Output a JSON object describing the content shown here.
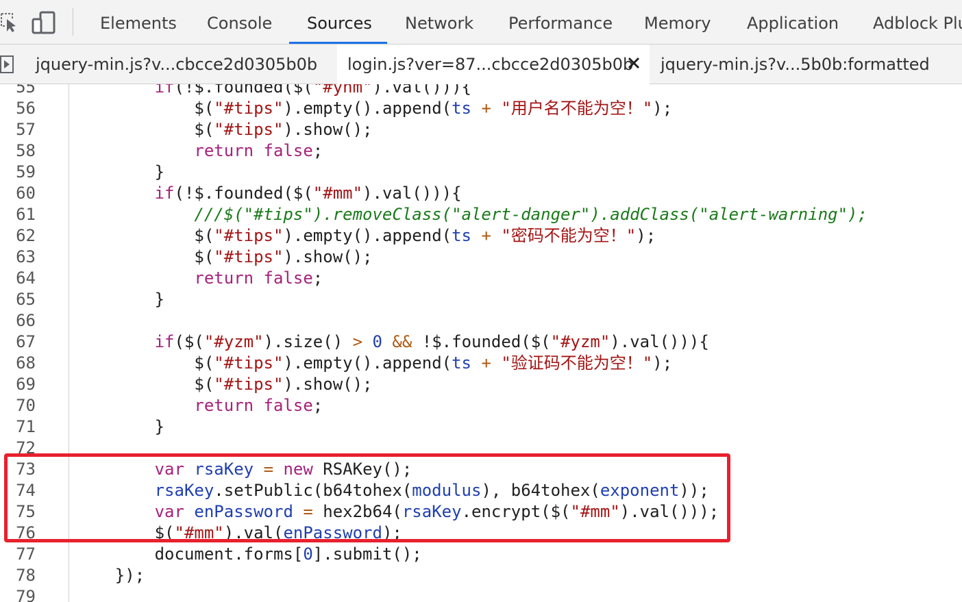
{
  "toolbar": {
    "tabs": [
      {
        "label": "Elements"
      },
      {
        "label": "Console"
      },
      {
        "label": "Sources"
      },
      {
        "label": "Network"
      },
      {
        "label": "Performance"
      },
      {
        "label": "Memory"
      },
      {
        "label": "Application"
      },
      {
        "label": "Adblock Plus"
      }
    ],
    "active_tab": "Sources",
    "icons": [
      "inspect-element-icon",
      "device-toggle-icon"
    ]
  },
  "file_tabs": [
    {
      "label": "jquery-min.js?v...cbcce2d0305b0b",
      "active": false
    },
    {
      "label": "login.js?ver=87...cbcce2d0305b0b",
      "active": true
    },
    {
      "label": "jquery-min.js?v...5b0b:formatted",
      "active": false
    }
  ],
  "colors": {
    "keyword": "#a5227c",
    "string": "#a31515",
    "comment": "#1a7a1a",
    "variable": "#1f3fb0",
    "highlight_border": "#e8202e",
    "active_tab_underline": "#1a73e8"
  },
  "code": {
    "highlighted_lines": [
      "73",
      "74",
      "75",
      "76"
    ],
    "lines": [
      {
        "n": "55",
        "segs": [
          {
            "t": "        "
          },
          {
            "t": "if",
            "c": "k"
          },
          {
            "t": "(!$.founded($("
          },
          {
            "t": "\"#ynm\"",
            "c": "s"
          },
          {
            "t": ").val())){"
          }
        ]
      },
      {
        "n": "56",
        "segs": [
          {
            "t": "            $("
          },
          {
            "t": "\"#tips\"",
            "c": "s"
          },
          {
            "t": ").empty().append("
          },
          {
            "t": "ts",
            "c": "v"
          },
          {
            "t": " "
          },
          {
            "t": "+",
            "c": "o"
          },
          {
            "t": " "
          },
          {
            "t": "\"用户名不能为空！\"",
            "c": "s"
          },
          {
            "t": ");"
          }
        ]
      },
      {
        "n": "57",
        "segs": [
          {
            "t": "            $("
          },
          {
            "t": "\"#tips\"",
            "c": "s"
          },
          {
            "t": ").show();"
          }
        ]
      },
      {
        "n": "58",
        "segs": [
          {
            "t": "            "
          },
          {
            "t": "return false",
            "c": "k"
          },
          {
            "t": ";"
          }
        ]
      },
      {
        "n": "59",
        "segs": [
          {
            "t": "        }"
          }
        ]
      },
      {
        "n": "60",
        "segs": [
          {
            "t": "        "
          },
          {
            "t": "if",
            "c": "k"
          },
          {
            "t": "(!$.founded($("
          },
          {
            "t": "\"#mm\"",
            "c": "s"
          },
          {
            "t": ").val())){"
          }
        ]
      },
      {
        "n": "61",
        "segs": [
          {
            "t": "            "
          },
          {
            "t": "///$(\"#tips\").removeClass(\"alert-danger\").addClass(\"alert-warning\");",
            "c": "c"
          }
        ]
      },
      {
        "n": "62",
        "segs": [
          {
            "t": "            $("
          },
          {
            "t": "\"#tips\"",
            "c": "s"
          },
          {
            "t": ").empty().append("
          },
          {
            "t": "ts",
            "c": "v"
          },
          {
            "t": " "
          },
          {
            "t": "+",
            "c": "o"
          },
          {
            "t": " "
          },
          {
            "t": "\"密码不能为空！\"",
            "c": "s"
          },
          {
            "t": ");"
          }
        ]
      },
      {
        "n": "63",
        "segs": [
          {
            "t": "            $("
          },
          {
            "t": "\"#tips\"",
            "c": "s"
          },
          {
            "t": ").show();"
          }
        ]
      },
      {
        "n": "64",
        "segs": [
          {
            "t": "            "
          },
          {
            "t": "return false",
            "c": "k"
          },
          {
            "t": ";"
          }
        ]
      },
      {
        "n": "65",
        "segs": [
          {
            "t": "        }"
          }
        ]
      },
      {
        "n": "66",
        "segs": [
          {
            "t": ""
          }
        ]
      },
      {
        "n": "67",
        "segs": [
          {
            "t": "        "
          },
          {
            "t": "if",
            "c": "k"
          },
          {
            "t": "($("
          },
          {
            "t": "\"#yzm\"",
            "c": "s"
          },
          {
            "t": ").size() "
          },
          {
            "t": ">",
            "c": "o"
          },
          {
            "t": " "
          },
          {
            "t": "0",
            "c": "n"
          },
          {
            "t": " "
          },
          {
            "t": "&&",
            "c": "o"
          },
          {
            "t": " !$.founded($("
          },
          {
            "t": "\"#yzm\"",
            "c": "s"
          },
          {
            "t": ").val())){"
          }
        ]
      },
      {
        "n": "68",
        "segs": [
          {
            "t": "            $("
          },
          {
            "t": "\"#tips\"",
            "c": "s"
          },
          {
            "t": ").empty().append("
          },
          {
            "t": "ts",
            "c": "v"
          },
          {
            "t": " "
          },
          {
            "t": "+",
            "c": "o"
          },
          {
            "t": " "
          },
          {
            "t": "\"验证码不能为空！\"",
            "c": "s"
          },
          {
            "t": ");"
          }
        ]
      },
      {
        "n": "69",
        "segs": [
          {
            "t": "            $("
          },
          {
            "t": "\"#tips\"",
            "c": "s"
          },
          {
            "t": ").show();"
          }
        ]
      },
      {
        "n": "70",
        "segs": [
          {
            "t": "            "
          },
          {
            "t": "return false",
            "c": "k"
          },
          {
            "t": ";"
          }
        ]
      },
      {
        "n": "71",
        "segs": [
          {
            "t": "        }"
          }
        ]
      },
      {
        "n": "72",
        "segs": [
          {
            "t": ""
          }
        ]
      },
      {
        "n": "73",
        "segs": [
          {
            "t": "        "
          },
          {
            "t": "var",
            "c": "k"
          },
          {
            "t": " "
          },
          {
            "t": "rsaKey",
            "c": "v"
          },
          {
            "t": " "
          },
          {
            "t": "=",
            "c": "o"
          },
          {
            "t": " "
          },
          {
            "t": "new",
            "c": "k"
          },
          {
            "t": " RSAKey();"
          }
        ]
      },
      {
        "n": "74",
        "segs": [
          {
            "t": "        "
          },
          {
            "t": "rsaKey",
            "c": "v"
          },
          {
            "t": ".setPublic(b64tohex("
          },
          {
            "t": "modulus",
            "c": "v"
          },
          {
            "t": "), b64tohex("
          },
          {
            "t": "exponent",
            "c": "v"
          },
          {
            "t": "));"
          }
        ]
      },
      {
        "n": "75",
        "segs": [
          {
            "t": "        "
          },
          {
            "t": "var",
            "c": "k"
          },
          {
            "t": " "
          },
          {
            "t": "enPassword",
            "c": "v"
          },
          {
            "t": " "
          },
          {
            "t": "=",
            "c": "o"
          },
          {
            "t": " hex2b64("
          },
          {
            "t": "rsaKey",
            "c": "v"
          },
          {
            "t": ".encrypt($("
          },
          {
            "t": "\"#mm\"",
            "c": "s"
          },
          {
            "t": ").val()));"
          }
        ]
      },
      {
        "n": "76",
        "segs": [
          {
            "t": "        $("
          },
          {
            "t": "\"#mm\"",
            "c": "s"
          },
          {
            "t": ").val("
          },
          {
            "t": "enPassword",
            "c": "v"
          },
          {
            "t": ");"
          }
        ]
      },
      {
        "n": "77",
        "segs": [
          {
            "t": "        document.forms["
          },
          {
            "t": "0",
            "c": "n"
          },
          {
            "t": "].submit();"
          }
        ]
      },
      {
        "n": "78",
        "segs": [
          {
            "t": "    });"
          }
        ]
      },
      {
        "n": "79",
        "segs": [
          {
            "t": ""
          }
        ]
      }
    ]
  }
}
